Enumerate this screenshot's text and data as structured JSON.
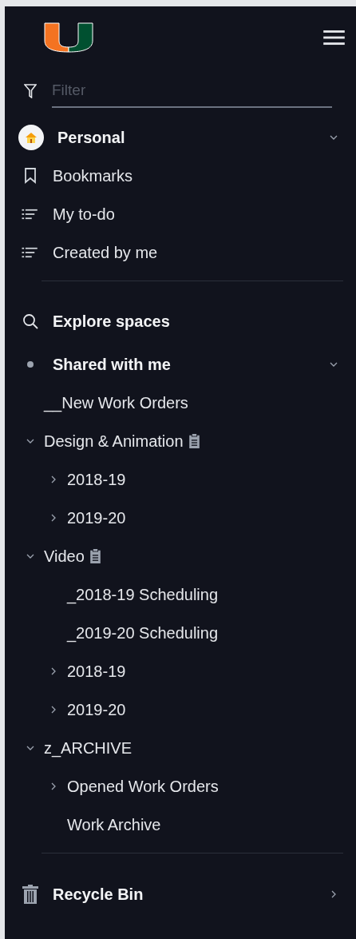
{
  "filter": {
    "placeholder": "Filter"
  },
  "personal": {
    "label": "Personal",
    "expanded": true,
    "items": [
      {
        "label": "Bookmarks",
        "kind": "bookmark"
      },
      {
        "label": "My to-do",
        "kind": "list"
      },
      {
        "label": "Created by me",
        "kind": "list"
      }
    ]
  },
  "explore": {
    "label": "Explore spaces"
  },
  "shared": {
    "label": "Shared with me",
    "expanded": true,
    "items": [
      {
        "label": "__New Work Orders",
        "kind": "page"
      },
      {
        "label": "Design & Animation",
        "kind": "board",
        "expanded": true,
        "children": [
          {
            "label": "2018-19",
            "kind": "folder",
            "expanded": false
          },
          {
            "label": "2019-20",
            "kind": "folder",
            "expanded": false
          }
        ]
      },
      {
        "label": "Video",
        "kind": "board",
        "expanded": true,
        "children": [
          {
            "label": "_2018-19 Scheduling",
            "kind": "page"
          },
          {
            "label": "_2019-20 Scheduling",
            "kind": "page"
          },
          {
            "label": "2018-19",
            "kind": "folder",
            "expanded": false
          },
          {
            "label": "2019-20",
            "kind": "folder",
            "expanded": false
          }
        ]
      },
      {
        "label": "z_ARCHIVE",
        "kind": "folder",
        "expanded": true,
        "children": [
          {
            "label": "Opened Work Orders",
            "kind": "folder",
            "expanded": false
          },
          {
            "label": "Work Archive",
            "kind": "page"
          }
        ]
      }
    ]
  },
  "recycle_bin": {
    "label": "Recycle Bin"
  }
}
